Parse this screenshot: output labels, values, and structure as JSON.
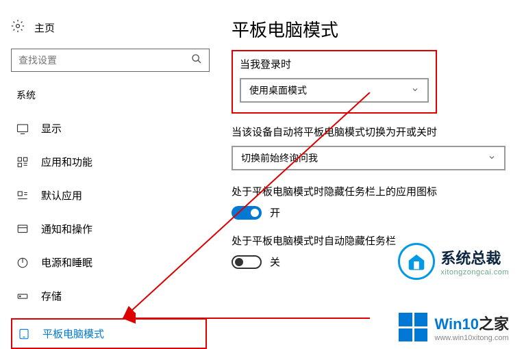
{
  "sidebar": {
    "home": "主页",
    "search_placeholder": "查找设置",
    "section": "系统",
    "items": [
      {
        "label": "显示"
      },
      {
        "label": "应用和功能"
      },
      {
        "label": "默认应用"
      },
      {
        "label": "通知和操作"
      },
      {
        "label": "电源和睡眠"
      },
      {
        "label": "存储"
      },
      {
        "label": "平板电脑模式"
      }
    ]
  },
  "main": {
    "title": "平板电脑模式",
    "login": {
      "label": "当我登录时",
      "value": "使用桌面模式"
    },
    "auto_switch": {
      "label": "当该设备自动将平板电脑模式切换为开或关时",
      "value": "切换前始终询问我"
    },
    "hide_icons": {
      "label": "处于平板电脑模式时隐藏任务栏上的应用图标",
      "state": "开"
    },
    "hide_taskbar": {
      "label": "处于平板电脑模式时自动隐藏任务栏",
      "state": "关"
    }
  },
  "watermark1": {
    "title": "系统总裁",
    "url": "xitongzongcai.com"
  },
  "watermark2": {
    "title_a": "Win10",
    "title_b": "之家",
    "url": "www.win10xitong.com"
  }
}
